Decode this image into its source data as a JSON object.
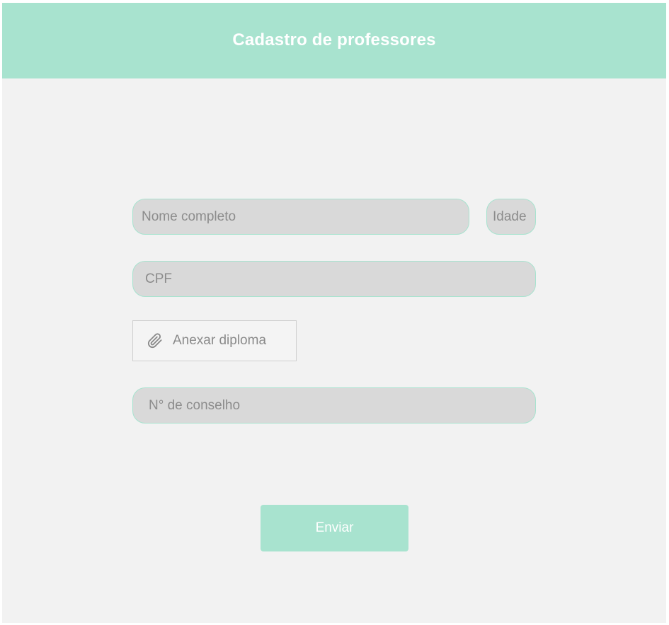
{
  "header": {
    "title": "Cadastro de professores"
  },
  "form": {
    "name_field": {
      "placeholder": "Nome completo",
      "value": ""
    },
    "age_field": {
      "placeholder": "Idade",
      "value": ""
    },
    "cpf_field": {
      "placeholder": "CPF",
      "value": ""
    },
    "attach_button": {
      "label": "Anexar diploma",
      "icon": "paperclip-icon"
    },
    "council_field": {
      "placeholder": "N° de conselho",
      "value": ""
    },
    "submit_button": {
      "label": "Enviar"
    }
  },
  "colors": {
    "accent": "#a8e3cf",
    "background": "#f2f2f2",
    "field_fill": "#d9d9d9",
    "placeholder_text": "#8c8c8c"
  }
}
